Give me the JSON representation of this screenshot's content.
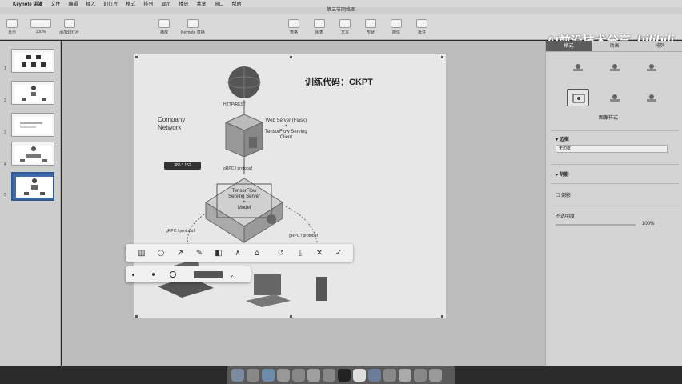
{
  "menubar": {
    "app_name": "Keynote 讲演",
    "items": [
      "文件",
      "编辑",
      "插入",
      "幻灯片",
      "格式",
      "排列",
      "显示",
      "播放",
      "共享",
      "窗口",
      "帮助"
    ]
  },
  "window": {
    "title": "第三节网络图"
  },
  "toolbar": {
    "items": [
      {
        "label": "显示",
        "icon": "display-icon"
      },
      {
        "label": "100%",
        "icon": "zoom-icon"
      },
      {
        "label": "添加幻灯片",
        "icon": "add-slide-icon"
      },
      {
        "label": "播放",
        "icon": "play-icon"
      },
      {
        "label": "Keynote 直播",
        "icon": "keynote-live-icon"
      },
      {
        "label": "表格",
        "icon": "table-icon"
      },
      {
        "label": "图表",
        "icon": "chart-icon"
      },
      {
        "label": "文本",
        "icon": "text-icon"
      },
      {
        "label": "形状",
        "icon": "shape-icon"
      },
      {
        "label": "媒体",
        "icon": "media-icon"
      },
      {
        "label": "批注",
        "icon": "comment-icon"
      }
    ]
  },
  "watermark": {
    "text": "AI前沿技术分享",
    "brand": "bilibili"
  },
  "slides": {
    "numbers": [
      "1",
      "2",
      "3",
      "4",
      "5"
    ],
    "selected_index": 5
  },
  "slide_content": {
    "title_code": "训练代码：CKPT",
    "company_network_1": "Company",
    "company_network_2": "Network",
    "rest_label": "HTTP/REST",
    "web_server_label": "Web Server (Flask)",
    "plus": "+",
    "tf_client_1": "TensorFlow Serving",
    "tf_client_2": "Client",
    "grpc_label_top": "gRPC / protobuf",
    "serving_server_1": "TensorFlow",
    "serving_server_2": "Serving Server",
    "serving_plus": "+",
    "serving_model": "Model",
    "grpc_label_left": "gRPC / protobuf",
    "grpc_label_right": "gRPC / protobuf"
  },
  "capture": {
    "size_label": "386 * 152",
    "tools": [
      "mosaic-icon",
      "ellipse-icon",
      "arrow-icon",
      "pencil-icon",
      "blur-icon",
      "text-icon",
      "tag-icon",
      "undo-icon",
      "download-icon",
      "close-icon",
      "confirm-icon"
    ],
    "tool_glyphs": [
      "▥",
      "○",
      "↗",
      "✎",
      "◧",
      "∧",
      "⌂",
      "↺",
      "⤓",
      "✕",
      "✓"
    ]
  },
  "right_panel": {
    "tabs": [
      "格式",
      "动画",
      "排列"
    ],
    "active_tab": 0,
    "style_label": "图像样式",
    "border_label": "边框",
    "border_value": "无边框",
    "shadow_label": "阴影",
    "reflection_label": "倒影",
    "opacity_label": "不透明度",
    "opacity_value": "100%"
  },
  "colors": {
    "desktop": "#2b2b2b",
    "selected_thumb": "#3f6aa8",
    "accent": "#5c5c5c"
  }
}
